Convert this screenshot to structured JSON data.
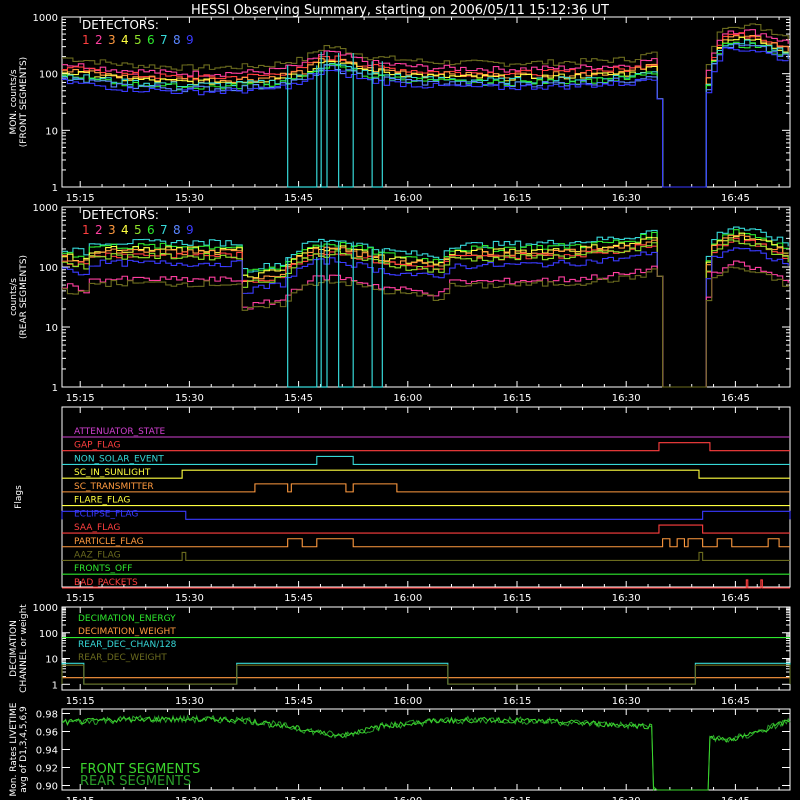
{
  "title": "HESSI Observing Summary, starting on 2006/05/11 15:12:36 UT",
  "colors": {
    "bg": "#000000",
    "axes": "#ffffff",
    "det": [
      "#ff3f3f",
      "#ff3fa0",
      "#ff9a3f",
      "#ffff40",
      "#8fe02a",
      "#2ee82e",
      "#36d8d8",
      "#5a86ff",
      "#3a3aff"
    ],
    "front": "#3bd52e",
    "rear": "#2a9e2a"
  },
  "x_ticks": [
    "15:15",
    "15:30",
    "15:45",
    "16:00",
    "16:15",
    "16:30",
    "16:45"
  ],
  "chart_data": [
    {
      "id": "front",
      "type": "line",
      "legend_title": "DETECTORS:",
      "legend_numbers": [
        "1",
        "2",
        "3",
        "4",
        "5",
        "6",
        "7",
        "8",
        "9"
      ],
      "ylabel": [
        "MON. counts/s",
        "(FRONT SEGMENTS)"
      ],
      "yscale": "log",
      "ylim": [
        1,
        1000
      ],
      "y_ticks": [
        "1",
        "10",
        "100",
        "1000"
      ],
      "xlim": [
        "15:12:36",
        "16:52:36"
      ],
      "series": [
        {
          "color": "#6b6b1e",
          "scale": 1.65
        },
        {
          "color": "#ff3fa0",
          "scale": 1.3
        },
        {
          "color": "#ff3f3f",
          "scale": 1.1
        },
        {
          "color": "#ff9a3f",
          "scale": 1.0
        },
        {
          "color": "#ffff40",
          "scale": 0.92
        },
        {
          "color": "#36d8d8",
          "scale": 0.82
        },
        {
          "color": "#2ee82e",
          "scale": 0.75
        },
        {
          "color": "#5a86ff",
          "scale": 0.7
        },
        {
          "color": "#3a3aff",
          "scale": 0.62
        }
      ],
      "base_profile": [
        [
          0,
          115
        ],
        [
          8,
          88
        ],
        [
          16,
          78
        ],
        [
          22,
          78
        ],
        [
          28,
          85
        ],
        [
          33,
          110
        ],
        [
          36,
          185
        ],
        [
          38,
          165
        ],
        [
          42,
          120
        ],
        [
          50,
          98
        ],
        [
          60,
          92
        ],
        [
          70,
          98
        ],
        [
          78,
          110
        ],
        [
          81,
          140
        ],
        [
          82,
          1
        ],
        [
          88,
          1
        ],
        [
          89,
          160
        ],
        [
          91,
          450
        ],
        [
          95,
          420
        ],
        [
          100,
          250
        ]
      ],
      "drops": [
        {
          "color": "#36d8d8",
          "segments": [
            [
              31,
              35,
              1
            ],
            [
              35.6,
              36.4,
              1
            ],
            [
              38,
              40,
              1
            ],
            [
              42.6,
              44,
              1
            ]
          ]
        }
      ],
      "gaps": [
        [
          81,
          88.5
        ]
      ]
    },
    {
      "id": "rear",
      "type": "line",
      "legend_title": "DETECTORS:",
      "legend_numbers": [
        "1",
        "2",
        "3",
        "4",
        "5",
        "6",
        "7",
        "8",
        "9"
      ],
      "ylabel": [
        "counts/s",
        "(REAR SEGMENTS)"
      ],
      "yscale": "log",
      "ylim": [
        1,
        1000
      ],
      "y_ticks": [
        "1",
        "10",
        "100",
        "1000"
      ],
      "xlim": [
        "15:12:36",
        "16:52:36"
      ],
      "series": [
        {
          "color": "#36d8d8",
          "scale": 1.45
        },
        {
          "color": "#2ee82e",
          "scale": 1.25
        },
        {
          "color": "#ffff40",
          "scale": 1.1
        },
        {
          "color": "#ff9a3f",
          "scale": 1.0
        },
        {
          "color": "#ff3f3f",
          "scale": 0.9
        },
        {
          "color": "#8fe02a",
          "scale": 0.85
        },
        {
          "color": "#3a3aff",
          "scale": 0.65
        },
        {
          "color": "#ff3fa0",
          "scale": 0.35
        },
        {
          "color": "#6b6b1e",
          "scale": 0.3
        }
      ],
      "base_profile": [
        [
          0,
          140
        ],
        [
          3,
          120
        ],
        [
          4,
          180
        ],
        [
          24,
          175
        ],
        [
          24.5,
          60
        ],
        [
          30,
          80
        ],
        [
          34,
          180
        ],
        [
          37,
          200
        ],
        [
          40,
          170
        ],
        [
          44,
          130
        ],
        [
          52,
          100
        ],
        [
          53,
          160
        ],
        [
          60,
          165
        ],
        [
          70,
          180
        ],
        [
          78,
          220
        ],
        [
          81,
          280
        ],
        [
          82,
          1
        ],
        [
          88,
          1
        ],
        [
          89,
          200
        ],
        [
          92,
          330
        ],
        [
          98,
          200
        ],
        [
          100,
          150
        ]
      ],
      "drops": [
        {
          "color": "#36d8d8",
          "segments": [
            [
              31,
              35,
              1
            ],
            [
              35.6,
              36.4,
              1
            ],
            [
              38,
              40,
              1
            ],
            [
              42.6,
              44,
              1
            ]
          ]
        }
      ],
      "gaps": [
        [
          81,
          88.5
        ]
      ]
    },
    {
      "id": "flags",
      "type": "step",
      "ylabel": "Flags",
      "rows": [
        {
          "label": "ATTENUATOR_STATE",
          "color": "#d040d0",
          "steps": []
        },
        {
          "label": "GAP_FLAG",
          "color": "#ff3f3f",
          "steps": [
            [
              82,
              89
            ]
          ]
        },
        {
          "label": "NON_SOLAR_EVENT",
          "color": "#36d8d8",
          "steps": [
            [
              35,
              40
            ]
          ]
        },
        {
          "label": "SC_IN_SUNLIGHT",
          "color": "#ffff40",
          "steps": [
            [
              16.5,
              87.5
            ]
          ]
        },
        {
          "label": "SC_TRANSMITTER",
          "color": "#ff9a3f",
          "steps": [
            [
              26.5,
              31
            ],
            [
              31.5,
              39
            ],
            [
              40,
              46
            ]
          ]
        },
        {
          "label": "FLARE_FLAG",
          "color": "#ffff40",
          "steps": []
        },
        {
          "label": "ECLIPSE_FLAG",
          "color": "#3a3aff",
          "steps": [
            [
              0,
              17
            ],
            [
              88,
              100
            ]
          ]
        },
        {
          "label": "SAA_FLAG",
          "color": "#ff3f3f",
          "steps": [
            [
              82,
              88
            ]
          ]
        },
        {
          "label": "PARTICLE_FLAG",
          "color": "#ff9a3f",
          "steps": [
            [
              31,
              33
            ],
            [
              35,
              40
            ],
            [
              82.5,
              83.5
            ],
            [
              84.5,
              85.5
            ],
            [
              86,
              88
            ],
            [
              90,
              92
            ],
            [
              97,
              98.5
            ]
          ]
        },
        {
          "label": "AAZ_FLAG",
          "color": "#6b6b1e",
          "steps": [
            [
              16.5,
              17
            ],
            [
              87.5,
              88
            ]
          ]
        },
        {
          "label": "FRONTS_OFF",
          "color": "#2ee82e",
          "steps": []
        },
        {
          "label": "BAD_PACKETS",
          "color": "#ff3f3f",
          "steps": [
            [
              94,
              94.2
            ],
            [
              96,
              96.2
            ]
          ]
        }
      ],
      "xlim": [
        "15:12:36",
        "16:52:36"
      ]
    },
    {
      "id": "decimation",
      "type": "step",
      "ylabel": [
        "DECIMATION",
        "CHANNEL or weight"
      ],
      "yscale": "log",
      "ylim": [
        0.6,
        1000
      ],
      "y_ticks": [
        "1",
        "10",
        "100",
        "1000"
      ],
      "xlim": [
        "15:12:36",
        "16:52:36"
      ],
      "series": [
        {
          "name": "DECIMATION_ENERGY",
          "color": "#2ee82e",
          "constant": 65
        },
        {
          "name": "DECIMATION_WEIGHT",
          "color": "#ff9a3f",
          "constant": 1.8
        },
        {
          "name": "REAR_DEC_CHAN/128",
          "color": "#36d8d8",
          "steps": [
            [
              0,
              3,
              6.5
            ],
            [
              24,
              53,
              6.5
            ],
            [
              87,
              100,
              6.5
            ]
          ]
        },
        {
          "name": "REAR_DEC_WEIGHT",
          "color": "#6b6b1e",
          "steps": [
            [
              0,
              3,
              5.5
            ],
            [
              24,
              53,
              5.5
            ],
            [
              87,
              100,
              5.5
            ]
          ]
        }
      ]
    },
    {
      "id": "livetime",
      "type": "line",
      "ylabel": [
        "Mon. Rates LIVETIME",
        "avg of D1,3,4,5,6,9"
      ],
      "ylim": [
        0.895,
        0.985
      ],
      "y_ticks": [
        "0.90",
        "0.92",
        "0.94",
        "0.96",
        "0.98"
      ],
      "xlim": [
        "15:12:36",
        "16:52:36"
      ],
      "legend": [
        "FRONT SEGMENTS",
        "REAR SEGMENTS"
      ],
      "profile": [
        [
          0,
          0.97
        ],
        [
          10,
          0.974
        ],
        [
          25,
          0.973
        ],
        [
          32,
          0.964
        ],
        [
          38,
          0.955
        ],
        [
          44,
          0.966
        ],
        [
          52,
          0.972
        ],
        [
          60,
          0.973
        ],
        [
          70,
          0.97
        ],
        [
          80,
          0.966
        ],
        [
          81,
          0.966
        ],
        [
          81.2,
          0.895
        ],
        [
          81.5,
          0.895
        ],
        [
          88.8,
          0.895
        ],
        [
          89,
          0.955
        ],
        [
          91,
          0.95
        ],
        [
          94,
          0.955
        ],
        [
          100,
          0.972
        ]
      ],
      "gaps": [
        [
          81.5,
          89
        ]
      ]
    }
  ]
}
